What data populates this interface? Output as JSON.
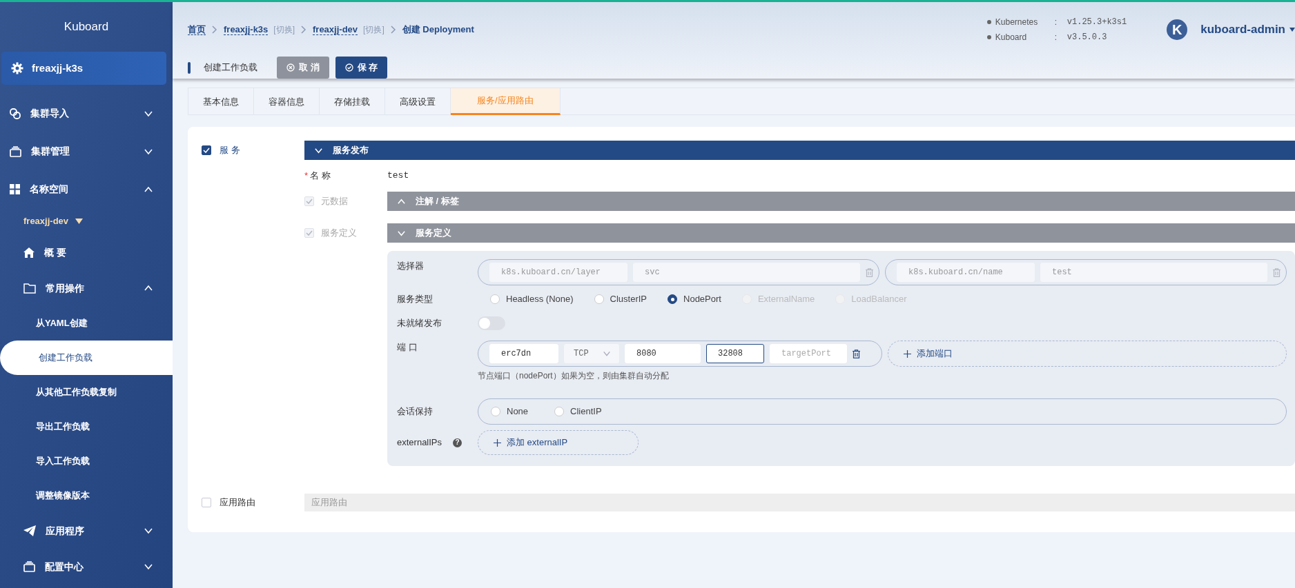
{
  "sidebar": {
    "title": "Kuboard",
    "cluster": {
      "label": "freaxjj-k3s"
    },
    "menu": [
      {
        "kind": "group",
        "label": "集群导入",
        "expanded": false
      },
      {
        "kind": "group",
        "label": "集群管理",
        "expanded": false
      },
      {
        "kind": "group",
        "label": "名称空间",
        "expanded": true,
        "namespace": "freaxjj-dev",
        "children": [
          {
            "kind": "link",
            "label": "概 要"
          },
          {
            "kind": "group",
            "label": "常用操作",
            "expanded": true,
            "children": [
              {
                "label": "从YAML创建",
                "selected": false
              },
              {
                "label": "创建工作负载",
                "selected": true
              },
              {
                "label": "从其他工作负载复制",
                "selected": false
              },
              {
                "label": "导出工作负载",
                "selected": false
              },
              {
                "label": "导入工作负载",
                "selected": false
              },
              {
                "label": "调整镜像版本",
                "selected": false
              }
            ]
          },
          {
            "kind": "group",
            "label": "应用程序",
            "expanded": false
          },
          {
            "kind": "group",
            "label": "配置中心",
            "expanded": false
          }
        ]
      }
    ]
  },
  "breadcrumb": [
    {
      "label": "首页"
    },
    {
      "label": "freaxjj-k3s",
      "switch": "[切换]"
    },
    {
      "label": "freaxjj-dev",
      "switch": "[切换]"
    },
    {
      "label": "创建 Deployment"
    }
  ],
  "versions": [
    {
      "name": "Kubernetes",
      "separator": ":",
      "value": "v1.25.3+k3s1"
    },
    {
      "name": "Kuboard",
      "separator": ":",
      "value": "v3.5.0.3"
    }
  ],
  "user": {
    "initial": "K",
    "name": "kuboard-admin"
  },
  "action_bar": {
    "title": "创建工作负载",
    "buttons": [
      {
        "kind": "cancel",
        "label": "取 消"
      },
      {
        "kind": "save",
        "label": "保 存"
      }
    ]
  },
  "tabs": [
    {
      "label": "基本信息",
      "selected": false
    },
    {
      "label": "容器信息",
      "selected": false
    },
    {
      "label": "存储挂载",
      "selected": false
    },
    {
      "label": "高级设置",
      "selected": false
    },
    {
      "label": "服务/应用路由",
      "selected": true
    }
  ],
  "service": {
    "label": "服 务",
    "checked": true,
    "title": "服务发布",
    "expanded": true,
    "name": {
      "label": "名 称",
      "required_mark": "*",
      "value": "test"
    },
    "metadata": {
      "label": "元数据",
      "checked": true,
      "disabled": true,
      "title": "注解 / 标签",
      "expanded": false
    },
    "definition": {
      "label": "服务定义",
      "checked": true,
      "disabled": true,
      "title": "服务定义",
      "expanded": true
    },
    "selector": {
      "label": "选择器",
      "pairs": [
        {
          "key": "k8s.kuboard.cn/layer",
          "value": "svc",
          "disabled": true
        },
        {
          "key": "k8s.kuboard.cn/name",
          "value": "test",
          "disabled": true
        }
      ]
    },
    "service_type": {
      "label": "服务类型",
      "options": [
        {
          "label": "Headless (None)",
          "selected": false,
          "disabled": false
        },
        {
          "label": "ClusterIP",
          "selected": false,
          "disabled": false
        },
        {
          "label": "NodePort",
          "selected": true,
          "disabled": false
        },
        {
          "label": "ExternalName",
          "selected": false,
          "disabled": true
        },
        {
          "label": "LoadBalancer",
          "selected": false,
          "disabled": true
        }
      ]
    },
    "unready": {
      "label": "未就绪发布",
      "on": false
    },
    "ports": {
      "label": "端 口",
      "rows": [
        {
          "fields": [
            {
              "kind": "text",
              "value": "erc7dn",
              "focused": false
            },
            {
              "kind": "select",
              "value": "TCP"
            },
            {
              "kind": "text",
              "value": "8080",
              "focused": false
            },
            {
              "kind": "text",
              "value": "32808",
              "focused": true
            },
            {
              "kind": "text",
              "placeholder": "targetPort",
              "focused": false
            }
          ]
        }
      ],
      "add_label": "添加端口",
      "hint": "节点端口（nodePort）如果为空，则由集群自动分配"
    },
    "session": {
      "label": "会话保持",
      "options": [
        {
          "label": "None",
          "selected": false
        },
        {
          "label": "ClientIP",
          "selected": false
        }
      ]
    },
    "external_ips": {
      "label": "externalIPs",
      "help": "?",
      "add_label": "添加 externalIP"
    }
  },
  "ingress": {
    "label": "应用路由",
    "checked": false,
    "title": "应用路由"
  }
}
